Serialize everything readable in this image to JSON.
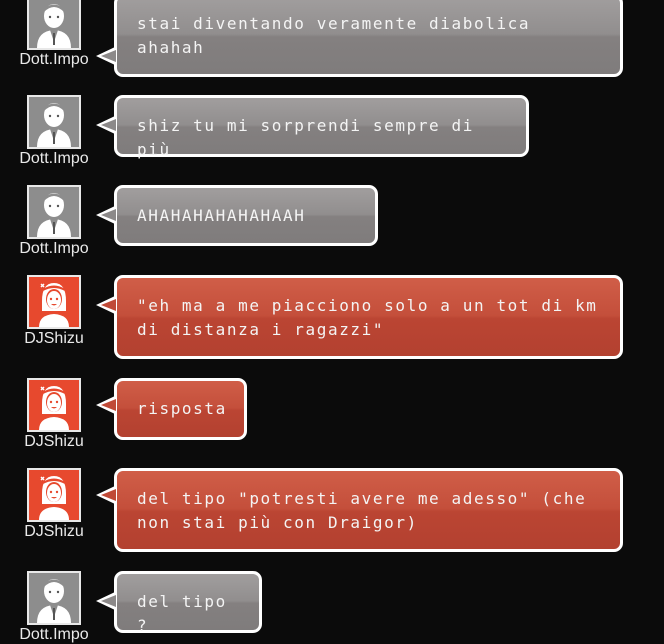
{
  "colors": {
    "background": "#0b0b0b",
    "bubble_gray": "#8f8c8c",
    "bubble_red": "#c04a37",
    "avatar_gray": "#8d8d8d",
    "avatar_red": "#e7492e",
    "bubble_border": "#ffffff"
  },
  "messages": [
    {
      "sender": "Dott.Impo",
      "avatar": "male-avatar-icon",
      "theme": "gray",
      "text": "stai diventando veramente diabolica\nahahah"
    },
    {
      "sender": "Dott.Impo",
      "avatar": "male-avatar-icon",
      "theme": "gray",
      "text": "shiz tu mi sorprendi sempre di più"
    },
    {
      "sender": "Dott.Impo",
      "avatar": "male-avatar-icon",
      "theme": "gray",
      "text": "AHAHAHAHAHAHAAH"
    },
    {
      "sender": "DJShizu",
      "avatar": "female-avatar-icon",
      "theme": "red",
      "text": "\"eh ma a me piacciono solo a un tot di km\ndi distanza i ragazzi\""
    },
    {
      "sender": "DJShizu",
      "avatar": "female-avatar-icon",
      "theme": "red",
      "text": "risposta"
    },
    {
      "sender": "DJShizu",
      "avatar": "female-avatar-icon",
      "theme": "red",
      "text": "del tipo \"potresti avere me adesso\" (che\nnon stai più con Draigor)"
    },
    {
      "sender": "Dott.Impo",
      "avatar": "male-avatar-icon",
      "theme": "gray",
      "text": "del tipo ?"
    }
  ]
}
